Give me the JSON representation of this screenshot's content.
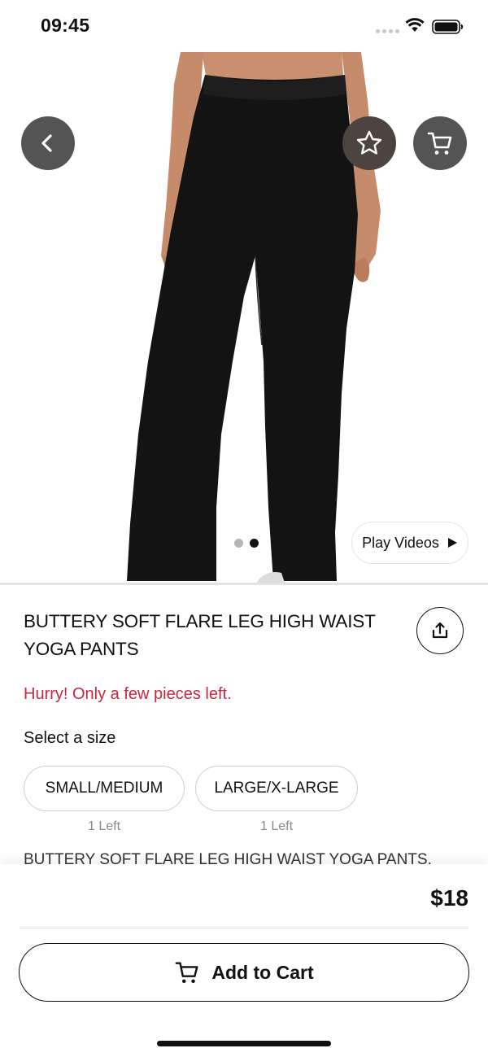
{
  "status_bar": {
    "time": "09:45"
  },
  "hero": {
    "image_alt": "Black flare leg yoga pants",
    "carousel": {
      "count": 2,
      "active_index": 1
    },
    "play_videos_label": "Play Videos"
  },
  "product": {
    "title": "BUTTERY SOFT FLARE LEG HIGH WAIST YOGA PANTS",
    "urgency": "Hurry! Only a few pieces left.",
    "size_label": "Select a size",
    "sizes": [
      {
        "label": "SMALL/MEDIUM",
        "stock": "1 Left"
      },
      {
        "label": "LARGE/X-LARGE",
        "stock": "1 Left"
      }
    ],
    "description": "BUTTERY SOFT FLARE LEG HIGH WAIST YOGA PANTS."
  },
  "checkout": {
    "price": "$18",
    "add_to_cart_label": "Add to Cart"
  },
  "icons": {
    "back": "chevron-left-icon",
    "favorite": "star-icon",
    "cart": "cart-icon",
    "share": "share-icon",
    "play": "play-icon"
  },
  "colors": {
    "urgency": "#c8283d",
    "icon_button": "#545454",
    "favorite_button": "#4d4440"
  }
}
